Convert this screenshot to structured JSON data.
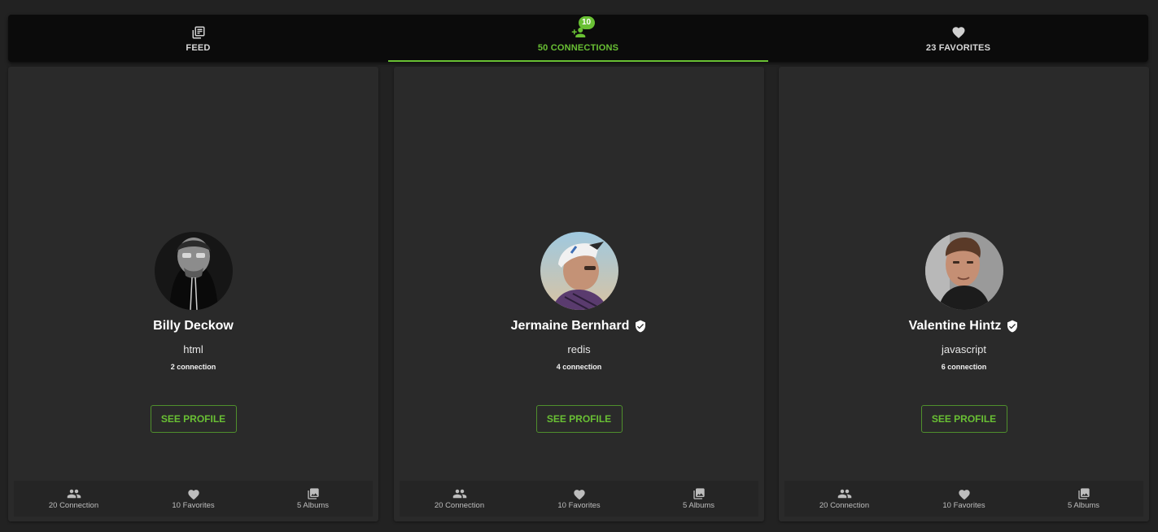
{
  "tabs": [
    {
      "label": "FEED",
      "icon": "feed-icon"
    },
    {
      "label": "50 CONNECTIONS",
      "icon": "connections-icon",
      "badge": "10",
      "active": true
    },
    {
      "label": "23 FAVORITES",
      "icon": "heart-icon"
    }
  ],
  "colors": {
    "accent": "#69c034",
    "background": "#222222",
    "card": "#2a2a2a",
    "tabbar": "#0b0b0b"
  },
  "cards": [
    {
      "name": "Billy Deckow",
      "verified": false,
      "skill": "html",
      "connections": "2 connection",
      "button": "SEE PROFILE",
      "stats": [
        {
          "label": "20 Connection",
          "icon": "people-icon"
        },
        {
          "label": "10 Favorites",
          "icon": "heart-icon"
        },
        {
          "label": "5 Albums",
          "icon": "albums-icon"
        }
      ]
    },
    {
      "name": "Jermaine Bernhard",
      "verified": true,
      "skill": "redis",
      "connections": "4 connection",
      "button": "SEE PROFILE",
      "stats": [
        {
          "label": "20 Connection",
          "icon": "people-icon"
        },
        {
          "label": "10 Favorites",
          "icon": "heart-icon"
        },
        {
          "label": "5 Albums",
          "icon": "albums-icon"
        }
      ]
    },
    {
      "name": "Valentine Hintz",
      "verified": true,
      "skill": "javascript",
      "connections": "6 connection",
      "button": "SEE PROFILE",
      "stats": [
        {
          "label": "20 Connection",
          "icon": "people-icon"
        },
        {
          "label": "10 Favorites",
          "icon": "heart-icon"
        },
        {
          "label": "5 Albums",
          "icon": "albums-icon"
        }
      ]
    }
  ]
}
